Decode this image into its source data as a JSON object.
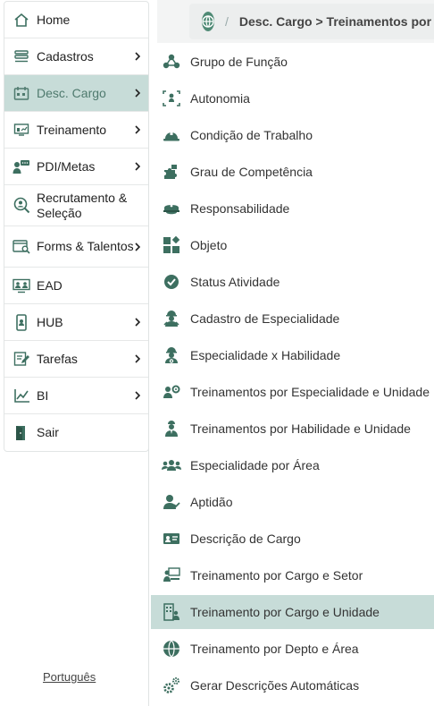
{
  "breadcrumb": {
    "separator": "/",
    "path": "Desc. Cargo > Treinamentos por Cargo e Unidade"
  },
  "colors": {
    "accent": "#4f8a75",
    "active_bg": "#c7dcd8"
  },
  "sidebar": {
    "items": [
      {
        "label": "Home",
        "icon": "home-icon"
      },
      {
        "label": "Cadastros",
        "icon": "list-icon"
      },
      {
        "label": "Desc. Cargo",
        "icon": "calendar-icon"
      },
      {
        "label": "Treinamento",
        "icon": "presentation-icon"
      },
      {
        "label": "PDI/Metas",
        "icon": "user-chat-icon"
      },
      {
        "label": "Recrutamento & Seleção",
        "icon": "search-user-icon"
      },
      {
        "label": "Forms & Talentos",
        "icon": "form-search-icon"
      },
      {
        "label": "EAD",
        "icon": "monitor-users-icon"
      },
      {
        "label": "HUB",
        "icon": "mobile-icon"
      },
      {
        "label": "Tarefas",
        "icon": "edit-task-icon"
      },
      {
        "label": "BI",
        "icon": "chart-icon"
      },
      {
        "label": "Sair",
        "icon": "exit-icon"
      }
    ]
  },
  "language": "Português",
  "submenu": {
    "items": [
      {
        "label": "Grupo de Função",
        "icon": "group-icon"
      },
      {
        "label": "Autonomia",
        "icon": "autonomy-icon"
      },
      {
        "label": "Condição de Trabalho",
        "icon": "hardhat-icon"
      },
      {
        "label": "Grau de Competência",
        "icon": "puzzle-icon"
      },
      {
        "label": "Responsabilidade",
        "icon": "cap-icon"
      },
      {
        "label": "Objeto",
        "icon": "objects-icon"
      },
      {
        "label": "Status Atividade",
        "icon": "check-circle-icon"
      },
      {
        "label": "Cadastro de Especialidade",
        "icon": "worker-icon"
      },
      {
        "label": "Especialidade x Habilidade",
        "icon": "worker-gear-icon"
      },
      {
        "label": "Treinamentos por Especialidade e Unidade",
        "icon": "users-gear-icon"
      },
      {
        "label": "Treinamentos por Habilidade e Unidade",
        "icon": "user-tie-icon"
      },
      {
        "label": "Especialidade por Área",
        "icon": "users-icon"
      },
      {
        "label": "Aptidão",
        "icon": "user-check-icon"
      },
      {
        "label": "Descrição de Cargo",
        "icon": "id-card-icon"
      },
      {
        "label": "Treinamento por Cargo e Setor",
        "icon": "teacher-icon"
      },
      {
        "label": "Treinamento por Cargo e Unidade",
        "icon": "building-user-icon"
      },
      {
        "label": "Treinamento por Depto e Área",
        "icon": "globe-icon"
      },
      {
        "label": "Gerar Descrições Automáticas",
        "icon": "gears-icon"
      }
    ]
  }
}
